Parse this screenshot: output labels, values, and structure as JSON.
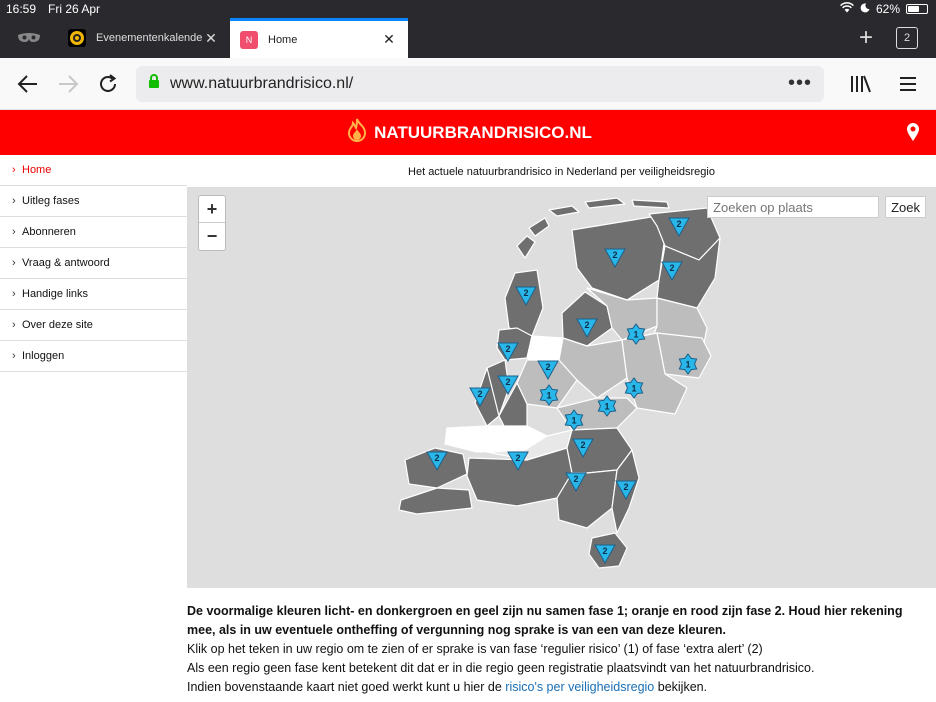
{
  "status": {
    "time": "16:59",
    "date": "Fri 26 Apr",
    "battery": "62%"
  },
  "tabs": [
    {
      "title": "Evenementenkalender",
      "active": false
    },
    {
      "title": "Home",
      "active": true,
      "favicon": "N"
    }
  ],
  "tab_count": "2",
  "url": "www.natuurbrandrisico.nl/",
  "site": {
    "logo_text": "NATUURBRANDRISICO.NL"
  },
  "sidebar": {
    "items": [
      {
        "label": "Home",
        "active": true
      },
      {
        "label": "Uitleg fases"
      },
      {
        "label": "Abonneren"
      },
      {
        "label": "Vraag & antwoord"
      },
      {
        "label": "Handige links"
      },
      {
        "label": "Over deze site"
      },
      {
        "label": "Inloggen"
      }
    ]
  },
  "main": {
    "heading": "Het actuele natuurbrandrisico in Nederland per veiligheidsregio",
    "search_placeholder": "Zoeken op plaats",
    "search_button": "Zoek",
    "zoom_in": "+",
    "zoom_out": "−"
  },
  "info": {
    "bold": "De voormalige kleuren licht- en donkergroen en geel zijn nu samen fase 1; oranje en rood zijn fase 2. Houd hier rekening mee, als in uw eventuele ontheffing of vergunning nog sprake is van een van deze kleuren.",
    "line1": "Klik op het teken in uw regio om te zien of er sprake is van fase ‘regulier risico’ (1) of fase ‘extra alert’ (2)",
    "line2": "Als een regio geen fase kent betekent dit dat er in die regio geen registratie plaatsvindt van het natuurbrandrisico.",
    "line3_before": "Indien bovenstaande kaart niet goed werkt kunt u hier de ",
    "line3_link": "risico's per veiligheidsregio",
    "line3_after": " bekijken."
  },
  "map_markers": [
    {
      "phase": "2",
      "shape": "triangle"
    },
    {
      "phase": "2",
      "shape": "triangle"
    },
    {
      "phase": "2",
      "shape": "triangle"
    },
    {
      "phase": "2",
      "shape": "triangle"
    },
    {
      "phase": "2",
      "shape": "triangle"
    },
    {
      "phase": "1",
      "shape": "star"
    },
    {
      "phase": "2",
      "shape": "triangle"
    },
    {
      "phase": "1",
      "shape": "star"
    },
    {
      "phase": "2",
      "shape": "triangle"
    },
    {
      "phase": "2",
      "shape": "triangle"
    },
    {
      "phase": "2",
      "shape": "triangle"
    },
    {
      "phase": "1",
      "shape": "star"
    },
    {
      "phase": "1",
      "shape": "star"
    },
    {
      "phase": "1",
      "shape": "star"
    },
    {
      "phase": "1",
      "shape": "star"
    },
    {
      "phase": "2",
      "shape": "triangle"
    },
    {
      "phase": "2",
      "shape": "triangle"
    },
    {
      "phase": "2",
      "shape": "triangle"
    },
    {
      "phase": "2",
      "shape": "triangle"
    },
    {
      "phase": "2",
      "shape": "triangle"
    },
    {
      "phase": "2",
      "shape": "triangle"
    }
  ],
  "colors": {
    "header_red": "#ff0000",
    "phase1": "#bdbdbd",
    "phase2": "#6f6f6f",
    "marker": "#29b6e8",
    "link": "#1a6fb5"
  }
}
